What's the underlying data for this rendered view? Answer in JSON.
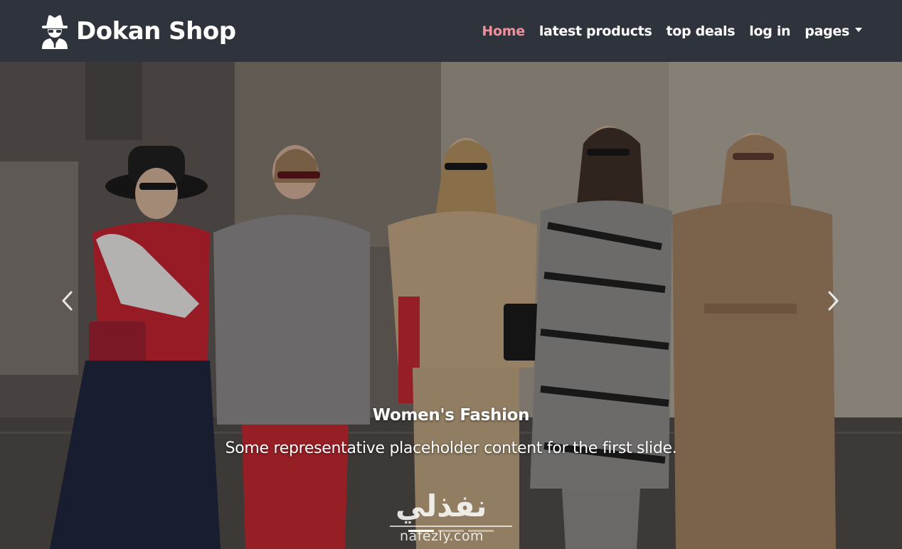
{
  "brand": {
    "name": "Dokan Shop",
    "icon": "spy-agent-icon"
  },
  "nav": {
    "items": [
      {
        "label": "Home",
        "active": true
      },
      {
        "label": "latest products",
        "active": false
      },
      {
        "label": "top deals",
        "active": false
      },
      {
        "label": "log in",
        "active": false
      },
      {
        "label": "pages",
        "active": false,
        "dropdown": true
      }
    ],
    "active_color": "#ef8f9a",
    "background": "#2f343c"
  },
  "carousel": {
    "slide": {
      "title": "Women's Fashion",
      "text": "Some representative placeholder content for the first slide.",
      "image": "street-style-women-walking-photo"
    },
    "prev_icon": "chevron-left-icon",
    "next_icon": "chevron-right-icon",
    "indicators": [
      true,
      false,
      false
    ]
  },
  "watermark": {
    "arabic": "نفذلي",
    "latin": "nafezly.com"
  }
}
